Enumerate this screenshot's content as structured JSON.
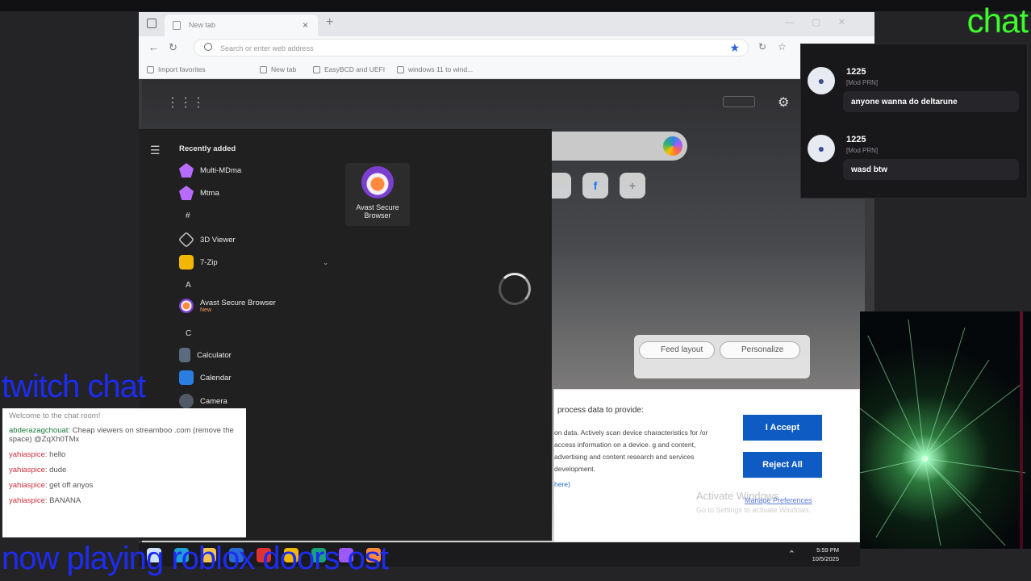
{
  "overlay": {
    "chat_title": "chat",
    "twitch_label": "twitch chat",
    "now_playing": "now playing roblox doors ost",
    "chat_title_color": "#3cff2c",
    "overlay_text_color": "#1d2cf0"
  },
  "browser": {
    "tab_label": "New tab",
    "address_placeholder": "Search or enter web address",
    "favorites": [
      {
        "label": "Import favorites"
      },
      {
        "label": "New tab"
      },
      {
        "label": "EasyBCD and UEFI"
      },
      {
        "label": "windows 11 to wind..."
      }
    ],
    "tiles": [
      "",
      "f",
      "+"
    ],
    "pill_feed": "Feed layout",
    "pill_personalize": "Personalize"
  },
  "start_menu": {
    "recently_added": "Recently added",
    "items": [
      {
        "label": "Multi-MDma",
        "icon": "multi-mdma-icon",
        "color": "#b86bff"
      },
      {
        "label": "Mtma",
        "icon": "mtma-icon",
        "color": "#b86bff"
      },
      {
        "label": "3D Viewer",
        "icon": "3d-viewer-icon",
        "color": "#9a9a9a"
      },
      {
        "label": "7-Zip",
        "icon": "folder-icon",
        "color": "#f2b705"
      },
      {
        "label": "Avast Secure Browser",
        "badge": "New",
        "icon": "avast-icon",
        "color": "#ff8a3d"
      },
      {
        "label": "Calculator",
        "icon": "calculator-icon",
        "color": "#5b6b7f"
      },
      {
        "label": "Calendar",
        "icon": "calendar-icon",
        "color": "#2a7de1"
      },
      {
        "label": "Camera",
        "icon": "camera-icon",
        "color": "#4f5a66"
      }
    ],
    "letters": [
      "#",
      "A",
      "C"
    ],
    "pinned_label": "Avast Secure Browser"
  },
  "consent": {
    "heading": "process data to provide:",
    "body": "on data. Actively scan device characteristics for /or access information on a device. g and content, advertising and content research and services development.",
    "link": "here)",
    "accept": "I Accept",
    "reject": "Reject All",
    "manage": "Manage Preferences",
    "activate_title": "Activate Windows",
    "activate_sub": "Go to Settings to activate Windows."
  },
  "taskbar": {
    "time": "5:59 PM",
    "date": "10/5/2025",
    "apps": [
      {
        "icon": "start-icon",
        "color": "#cfe3ff"
      },
      {
        "icon": "edge-icon",
        "color": "#1fa0d6"
      },
      {
        "icon": "file-explorer-icon",
        "color": "#f2c14e"
      },
      {
        "icon": "app-icon",
        "color": "#2a6bd8"
      },
      {
        "icon": "app-icon",
        "color": "#d33"
      },
      {
        "icon": "folder-icon",
        "color": "#f2b705"
      },
      {
        "icon": "app-icon",
        "color": "#1aa37a"
      },
      {
        "icon": "app-icon",
        "color": "#9b59f5"
      },
      {
        "icon": "app-icon",
        "color": "#ff8a3d"
      }
    ]
  },
  "chat": {
    "messages": [
      {
        "user": "1225",
        "role": "[Mod PRN]",
        "text": "anyone wanna do deltarune"
      },
      {
        "user": "1225",
        "role": "[Mod PRN]",
        "text": "wasd btw"
      }
    ]
  },
  "twitch_chat": {
    "welcome": "Welcome to the chat room!",
    "messages": [
      {
        "user": "abderazagchouat",
        "color": "#1a7a3a",
        "text": "Cheap viewers on streamboo .com (remove the space) @ZqXh0TMx"
      },
      {
        "user": "yahiaspice",
        "color": "#d0303f",
        "text": "hello"
      },
      {
        "user": "yahiaspice",
        "color": "#d0303f",
        "text": "dude"
      },
      {
        "user": "yahiaspice",
        "color": "#d0303f",
        "text": "get off anyos"
      },
      {
        "user": "yahiaspice",
        "color": "#d0303f",
        "text": "BANANA"
      }
    ]
  }
}
